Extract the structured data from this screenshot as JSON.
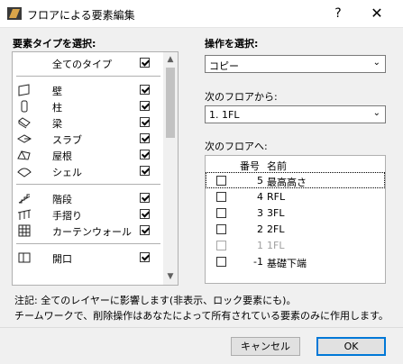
{
  "window": {
    "title": "フロアによる要素編集",
    "help": "?",
    "close": "✕"
  },
  "left": {
    "heading": "要素タイプを選択:",
    "all_types": {
      "label": "全てのタイプ",
      "checked": true
    },
    "group1": [
      {
        "icon": "wall-icon",
        "label": "壁",
        "checked": true
      },
      {
        "icon": "column-icon",
        "label": "柱",
        "checked": true
      },
      {
        "icon": "beam-icon",
        "label": "梁",
        "checked": true
      },
      {
        "icon": "slab-icon",
        "label": "スラブ",
        "checked": true
      },
      {
        "icon": "roof-icon",
        "label": "屋根",
        "checked": true
      },
      {
        "icon": "shell-icon",
        "label": "シェル",
        "checked": true
      }
    ],
    "group2": [
      {
        "icon": "stair-icon",
        "label": "階段",
        "checked": true
      },
      {
        "icon": "railing-icon",
        "label": "手摺り",
        "checked": true
      },
      {
        "icon": "curtain-wall-icon",
        "label": "カーテンウォール",
        "checked": true
      }
    ],
    "group3": [
      {
        "icon": "door-icon",
        "label": "開口",
        "checked": true
      }
    ]
  },
  "right": {
    "operation_heading": "操作を選択:",
    "operation_value": "コピー",
    "from_label": "次のフロアから:",
    "from_value": "1. 1FL",
    "to_label": "次のフロアへ:",
    "columns": {
      "number": "番号",
      "name": "名前"
    },
    "floors": [
      {
        "number": "5",
        "name": "最高高さ",
        "checked": false,
        "disabled": false,
        "focused": true
      },
      {
        "number": "4",
        "name": "RFL",
        "checked": false,
        "disabled": false,
        "focused": false
      },
      {
        "number": "3",
        "name": "3FL",
        "checked": false,
        "disabled": false,
        "focused": false
      },
      {
        "number": "2",
        "name": "2FL",
        "checked": false,
        "disabled": false,
        "focused": false
      },
      {
        "number": "1",
        "name": "1FL",
        "checked": false,
        "disabled": true,
        "focused": false
      },
      {
        "number": "-1",
        "name": "基礎下端",
        "checked": false,
        "disabled": false,
        "focused": false
      }
    ]
  },
  "notes": {
    "line1": "注記: 全てのレイヤーに影響します(非表示、ロック要素にも)。",
    "line2": "チームワークで、削除操作はあなたによって所有されている要素のみに作用します。"
  },
  "buttons": {
    "cancel": "キャンセル",
    "ok": "OK"
  }
}
